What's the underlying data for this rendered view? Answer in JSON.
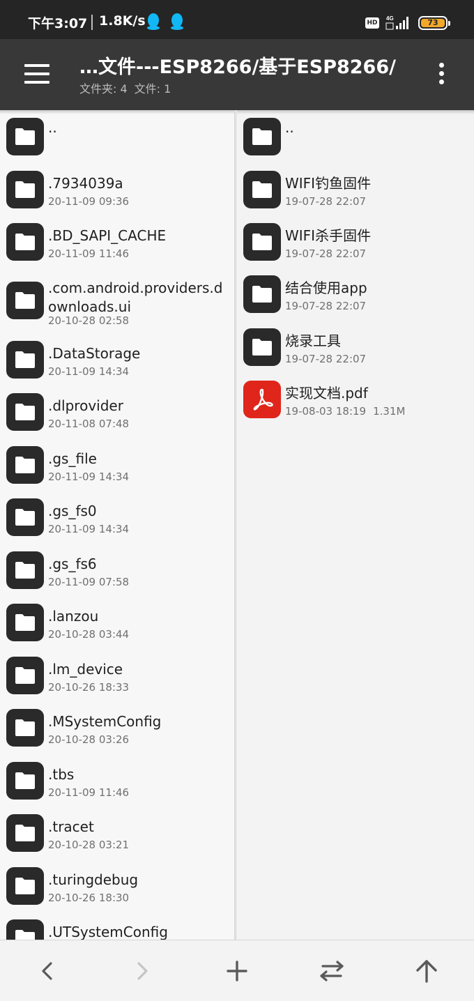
{
  "status_bar": {
    "time": "下午3:07",
    "speed": "1.8K/s",
    "hd_badge": "HD",
    "network": "4G",
    "battery_level": "73",
    "battery_color": "#f2a829"
  },
  "app_bar": {
    "title": "…文件---ESP8266/基于ESP8266/",
    "folder_count_label": "文件夹: 4",
    "file_count_label": "文件: 1",
    "menu_icon": "hamburger-icon",
    "more_icon": "more-vert-icon",
    "bg_color": "#383838"
  },
  "left_pane": {
    "items": [
      {
        "name": "..",
        "meta": "",
        "type": "folder"
      },
      {
        "name": ".7934039a",
        "meta": "20-11-09 09:36",
        "type": "folder"
      },
      {
        "name": ".BD_SAPI_CACHE",
        "meta": "20-11-09 11:46",
        "type": "folder"
      },
      {
        "name": ".com.android.providers.downloads.ui",
        "meta": "20-10-28 02:58",
        "type": "folder"
      },
      {
        "name": ".DataStorage",
        "meta": "20-11-09 14:34",
        "type": "folder"
      },
      {
        "name": ".dlprovider",
        "meta": "20-11-08 07:48",
        "type": "folder"
      },
      {
        "name": ".gs_file",
        "meta": "20-11-09 14:34",
        "type": "folder"
      },
      {
        "name": ".gs_fs0",
        "meta": "20-11-09 14:34",
        "type": "folder"
      },
      {
        "name": ".gs_fs6",
        "meta": "20-11-09 07:58",
        "type": "folder"
      },
      {
        "name": ".lanzou",
        "meta": "20-10-28 03:44",
        "type": "folder"
      },
      {
        "name": ".lm_device",
        "meta": "20-10-26 18:33",
        "type": "folder"
      },
      {
        "name": ".MSystemConfig",
        "meta": "20-10-28 03:26",
        "type": "folder"
      },
      {
        "name": ".tbs",
        "meta": "20-11-09 11:46",
        "type": "folder"
      },
      {
        "name": ".tracet",
        "meta": "20-10-28 03:21",
        "type": "folder"
      },
      {
        "name": ".turingdebug",
        "meta": "20-10-26 18:30",
        "type": "folder"
      },
      {
        "name": ".UTSystemConfig",
        "meta": "",
        "type": "folder"
      }
    ]
  },
  "right_pane": {
    "items": [
      {
        "name": "..",
        "meta": "",
        "size": "",
        "type": "folder"
      },
      {
        "name": "WIFI钓鱼固件",
        "meta": "19-07-28 22:07",
        "size": "",
        "type": "folder"
      },
      {
        "name": "WIFI杀手固件",
        "meta": "19-07-28 22:07",
        "size": "",
        "type": "folder"
      },
      {
        "name": "结合使用app",
        "meta": "19-07-28 22:07",
        "size": "",
        "type": "folder"
      },
      {
        "name": "烧录工具",
        "meta": "19-07-28 22:07",
        "size": "",
        "type": "folder"
      },
      {
        "name": "实现文档.pdf",
        "meta": "19-08-03 18:19",
        "size": "1.31M",
        "type": "pdf"
      }
    ]
  },
  "bottom_bar": {
    "buttons": [
      {
        "icon": "back-arrow-icon",
        "enabled": true
      },
      {
        "icon": "forward-arrow-icon",
        "enabled": false
      },
      {
        "icon": "add-icon",
        "enabled": true
      },
      {
        "icon": "swap-panes-icon",
        "enabled": true
      },
      {
        "icon": "parent-folder-icon",
        "enabled": true
      }
    ]
  }
}
